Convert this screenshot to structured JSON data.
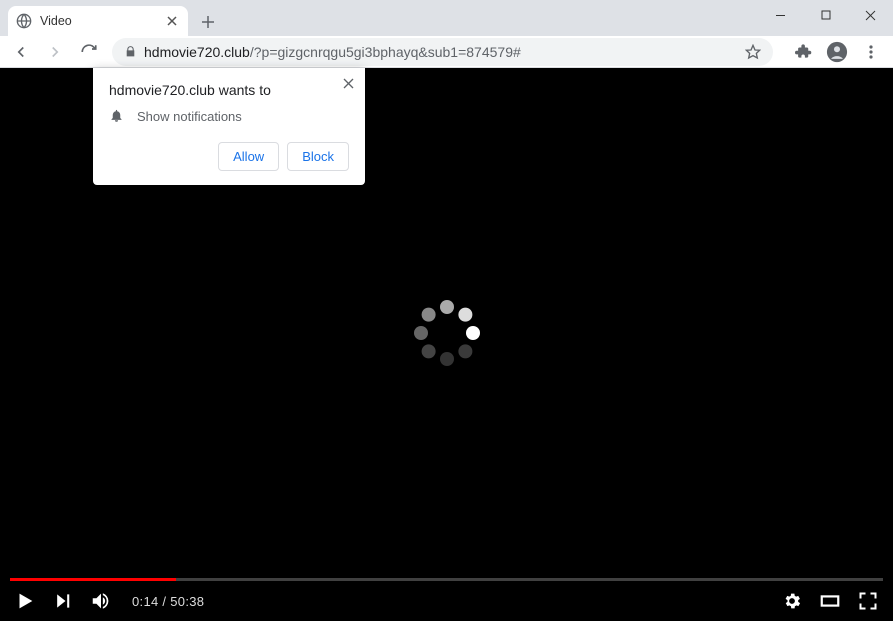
{
  "window": {
    "minimize_tooltip": "Minimize",
    "maximize_tooltip": "Maximize",
    "close_tooltip": "Close"
  },
  "tab": {
    "title": "Video"
  },
  "address_bar": {
    "host": "hdmovie720.club",
    "path": "/?p=gizgcnrqgu5gi3bphayq&sub1=874579#"
  },
  "permission_popup": {
    "title": "hdmovie720.club wants to",
    "request": "Show notifications",
    "allow": "Allow",
    "block": "Block"
  },
  "player": {
    "current_time": "0:14",
    "duration": "50:38",
    "separator": " / ",
    "progress_percent": 19
  }
}
